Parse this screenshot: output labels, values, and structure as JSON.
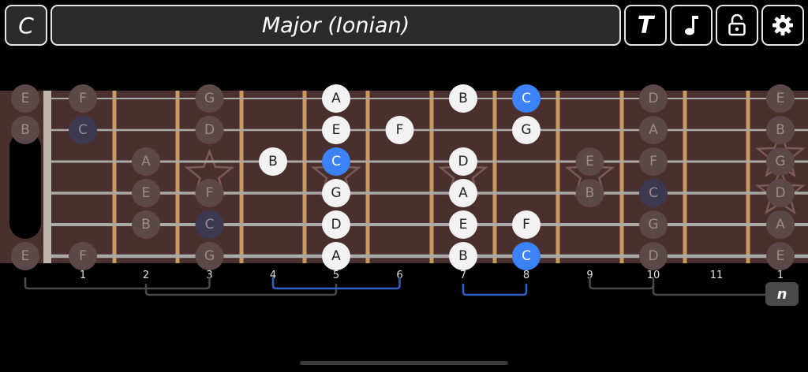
{
  "header": {
    "key_label": "C",
    "scale_label": "Major (Ionian)",
    "tuning_label": "T",
    "icons": {
      "sound": "music-note-icon",
      "lock": "lock-open-icon",
      "settings": "gear-icon"
    }
  },
  "colors": {
    "board": "#4a2f2f",
    "fret": "#c99a5d",
    "string": "#a9a9a9",
    "note_active": "#f2f2f2",
    "note_root": "#3b82f6",
    "note_ghost": "#5c4848",
    "note_ghost_root": "#3c3850",
    "position_bracket": "#4a4a4a",
    "position_bracket_active": "#2f5fc4"
  },
  "fretboard": {
    "fret_numbers": [
      "1",
      "2",
      "3",
      "4",
      "5",
      "6",
      "7",
      "8",
      "9",
      "10",
      "11",
      "1"
    ],
    "strings": [
      "E",
      "B",
      "G",
      "D",
      "A",
      "E"
    ],
    "marker_frets": [
      3,
      5,
      7,
      9,
      12
    ],
    "active_window": [
      4,
      8
    ],
    "position_brackets": [
      {
        "from": 0,
        "to": 3,
        "row": 0,
        "active": false
      },
      {
        "from": 2,
        "to": 5,
        "row": 1,
        "active": false
      },
      {
        "from": 4,
        "to": 6,
        "row": 0,
        "active": true
      },
      {
        "from": 7,
        "to": 8,
        "row": 1,
        "active": true
      },
      {
        "from": 9,
        "to": 10,
        "row": 0,
        "active": false
      },
      {
        "from": 10,
        "to": 12,
        "row": 1,
        "active": false
      }
    ],
    "notes": [
      {
        "s": 0,
        "f": 0,
        "n": "E"
      },
      {
        "s": 0,
        "f": 1,
        "n": "F"
      },
      {
        "s": 0,
        "f": 3,
        "n": "G"
      },
      {
        "s": 0,
        "f": 5,
        "n": "A"
      },
      {
        "s": 0,
        "f": 7,
        "n": "B"
      },
      {
        "s": 0,
        "f": 8,
        "n": "C"
      },
      {
        "s": 0,
        "f": 10,
        "n": "D"
      },
      {
        "s": 0,
        "f": 12,
        "n": "E"
      },
      {
        "s": 1,
        "f": 0,
        "n": "B"
      },
      {
        "s": 1,
        "f": 1,
        "n": "C"
      },
      {
        "s": 1,
        "f": 3,
        "n": "D"
      },
      {
        "s": 1,
        "f": 5,
        "n": "E"
      },
      {
        "s": 1,
        "f": 6,
        "n": "F"
      },
      {
        "s": 1,
        "f": 8,
        "n": "G"
      },
      {
        "s": 1,
        "f": 10,
        "n": "A"
      },
      {
        "s": 1,
        "f": 12,
        "n": "B"
      },
      {
        "s": 2,
        "f": 2,
        "n": "A"
      },
      {
        "s": 2,
        "f": 4,
        "n": "B"
      },
      {
        "s": 2,
        "f": 5,
        "n": "C"
      },
      {
        "s": 2,
        "f": 7,
        "n": "D"
      },
      {
        "s": 2,
        "f": 9,
        "n": "E"
      },
      {
        "s": 2,
        "f": 10,
        "n": "F"
      },
      {
        "s": 2,
        "f": 12,
        "n": "G"
      },
      {
        "s": 3,
        "f": 2,
        "n": "E"
      },
      {
        "s": 3,
        "f": 3,
        "n": "F"
      },
      {
        "s": 3,
        "f": 5,
        "n": "G"
      },
      {
        "s": 3,
        "f": 7,
        "n": "A"
      },
      {
        "s": 3,
        "f": 9,
        "n": "B"
      },
      {
        "s": 3,
        "f": 10,
        "n": "C"
      },
      {
        "s": 3,
        "f": 12,
        "n": "D"
      },
      {
        "s": 4,
        "f": 2,
        "n": "B"
      },
      {
        "s": 4,
        "f": 3,
        "n": "C"
      },
      {
        "s": 4,
        "f": 5,
        "n": "D"
      },
      {
        "s": 4,
        "f": 7,
        "n": "E"
      },
      {
        "s": 4,
        "f": 8,
        "n": "F"
      },
      {
        "s": 4,
        "f": 10,
        "n": "G"
      },
      {
        "s": 4,
        "f": 12,
        "n": "A"
      },
      {
        "s": 5,
        "f": 0,
        "n": "E"
      },
      {
        "s": 5,
        "f": 1,
        "n": "F"
      },
      {
        "s": 5,
        "f": 3,
        "n": "G"
      },
      {
        "s": 5,
        "f": 5,
        "n": "A"
      },
      {
        "s": 5,
        "f": 7,
        "n": "B"
      },
      {
        "s": 5,
        "f": 8,
        "n": "C"
      },
      {
        "s": 5,
        "f": 10,
        "n": "D"
      },
      {
        "s": 5,
        "f": 12,
        "n": "E"
      }
    ]
  },
  "position_button_label": "n"
}
